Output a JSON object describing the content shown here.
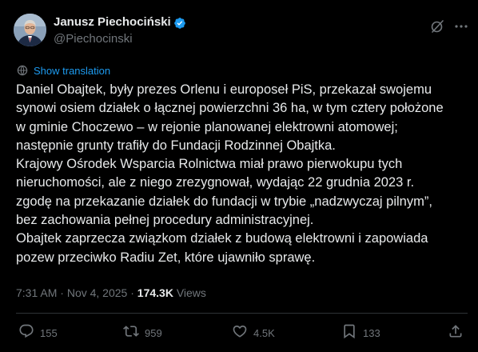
{
  "author": {
    "name": "Janusz Piechociński",
    "handle": "@Piechocinski"
  },
  "translate_label": "Show translation",
  "tweet_lines": [
    "Daniel Obajtek, były prezes Orlenu i europoseł PiS, przekazał swojemu",
    "synowi osiem działek o łącznej powierzchni 36 ha, w tym cztery położone",
    "w gminie Choczewo – w rejonie planowanej elektrowni atomowej;",
    "następnie grunty trafiły do Fundacji Rodzinnej Obajtka.",
    "Krajowy Ośrodek Wsparcia Rolnictwa miał prawo pierwokupu tych",
    "nieruchomości, ale z niego zrezygnował, wydając 22 grudnia 2023 r.",
    "zgodę na przekazanie działek do fundacji w trybie „nadzwyczaj pilnym”,",
    "bez zachowania pełnej procedury administracyjnej.",
    "Obajtek zaprzecza związkom działek z budową elektrowni i zapowiada",
    "pozew przeciwko Radiu Zet, które ujawniło sprawę."
  ],
  "meta": {
    "time": "7:31 AM",
    "separator": " · ",
    "date": "Nov 4, 2025",
    "views_count": "174.3K",
    "views_label": "Views"
  },
  "actions": {
    "replies": "155",
    "reposts": "959",
    "likes": "4.5K",
    "bookmarks": "133"
  },
  "icons": {
    "verified": "verified-badge-icon",
    "grok": "grok-icon",
    "more": "more-icon",
    "translate": "translate-globe-icon",
    "reply": "reply-icon",
    "repost": "repost-icon",
    "like": "heart-icon",
    "bookmark": "bookmark-icon",
    "share": "share-icon"
  },
  "colors": {
    "background": "#000000",
    "text": "#e7e9ea",
    "secondary": "#71767b",
    "accent": "#1d9bf0",
    "divider": "#2f3336"
  }
}
